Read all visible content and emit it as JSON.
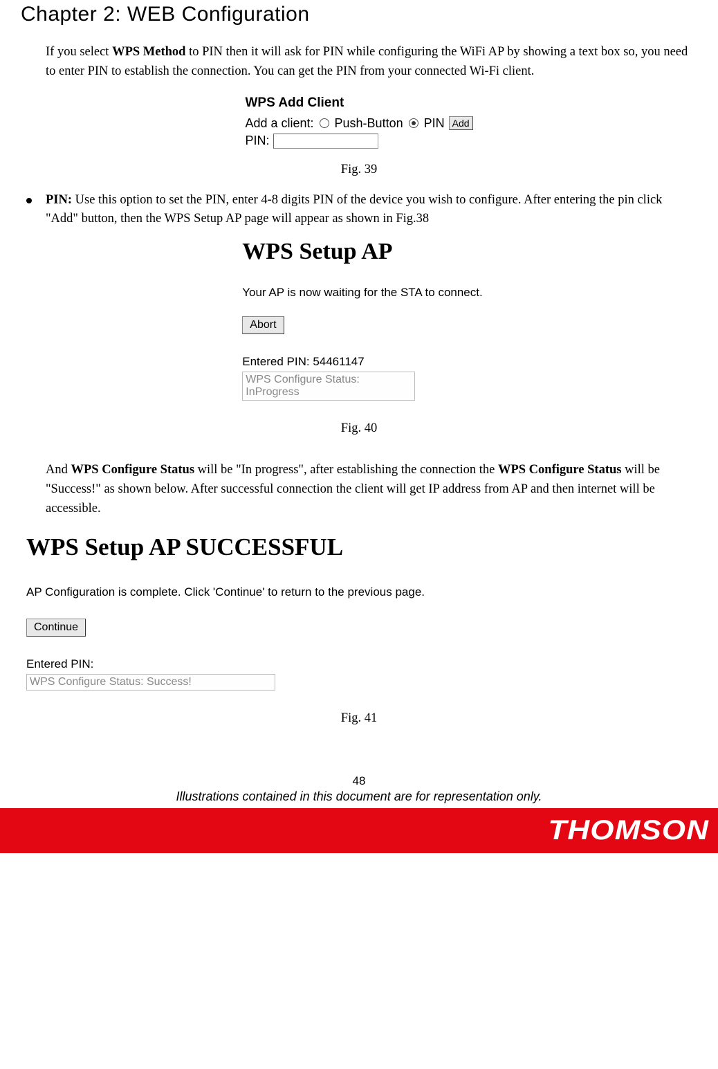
{
  "chapter_title": "Chapter 2: WEB Configuration",
  "intro_paragraph": {
    "prefix": "If you select ",
    "bold1": "WPS Method",
    "rest": " to PIN then it will ask for PIN while configuring the WiFi AP by showing a text box so, you need to enter PIN to establish the connection. You can get the PIN from your connected Wi-Fi client."
  },
  "fig39": {
    "title": "WPS Add Client",
    "row_label": "Add a client:",
    "radio1": "Push-Button",
    "radio2": "PIN",
    "add_button": "Add",
    "pin_label": "PIN:",
    "caption": "Fig. 39"
  },
  "bullet_pin": {
    "bold": "PIN:",
    "t1": " Use this option to set the PIN, enter 4-8 digits PIN of the device you wish to configure. After entering the pin click \"Add\" button, then the WPS Setup AP page will appear as shown in Fig.38"
  },
  "fig40": {
    "title": "WPS Setup AP",
    "waiting_text": "Your AP is now waiting for the STA to connect.",
    "abort_button": "Abort",
    "entered_pin": "Entered PIN: 54461147",
    "status": "WPS Configure Status: InProgress",
    "caption": "Fig. 40"
  },
  "status_paragraph": {
    "p1": "And ",
    "b1": "WPS Configure Status",
    "p2": " will be \"In progress\", after establishing the connection the ",
    "b2": "WPS Configure Status",
    "p3": " will be \"Success!\" as shown below. After successful connection the client will get IP address from AP and then internet will be accessible."
  },
  "fig41": {
    "title": "WPS Setup AP SUCCESSFUL",
    "complete_text": "AP Configuration is complete. Click 'Continue' to return to the previous page.",
    "continue_button": "Continue",
    "entered_pin": "Entered PIN:",
    "status": "WPS Configure Status: Success!",
    "caption": "Fig. 41"
  },
  "footer": {
    "page_number": "48",
    "disclaimer": "Illustrations contained in this document are for representation only.",
    "logo": "THOMSON"
  }
}
